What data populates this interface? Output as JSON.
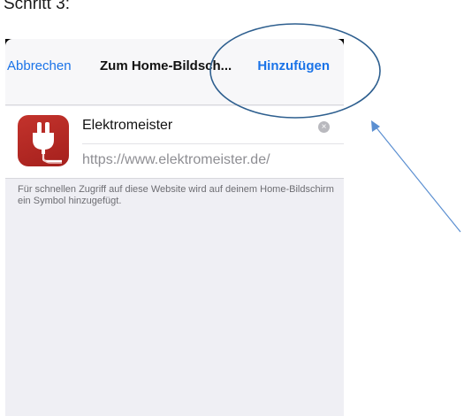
{
  "page": {
    "step_label": "Schritt 3:"
  },
  "dialog": {
    "cancel_label": "Abbrechen",
    "title": "Zum Home-Bildsch...",
    "add_label": "Hinzufügen"
  },
  "form": {
    "app_name": "Elektromeister",
    "clear_glyph": "×",
    "url": "https://www.elektromeister.de/",
    "app_icon": "plug-icon"
  },
  "help_text": "Für schnellen Zugriff auf diese Website wird auf deinem Home-Bildschirm ein Symbol hinzugefügt.",
  "colors": {
    "accent_blue": "#1a73e8",
    "icon_red": "#b52a25",
    "annotation_blue": "#2e5f8f"
  }
}
